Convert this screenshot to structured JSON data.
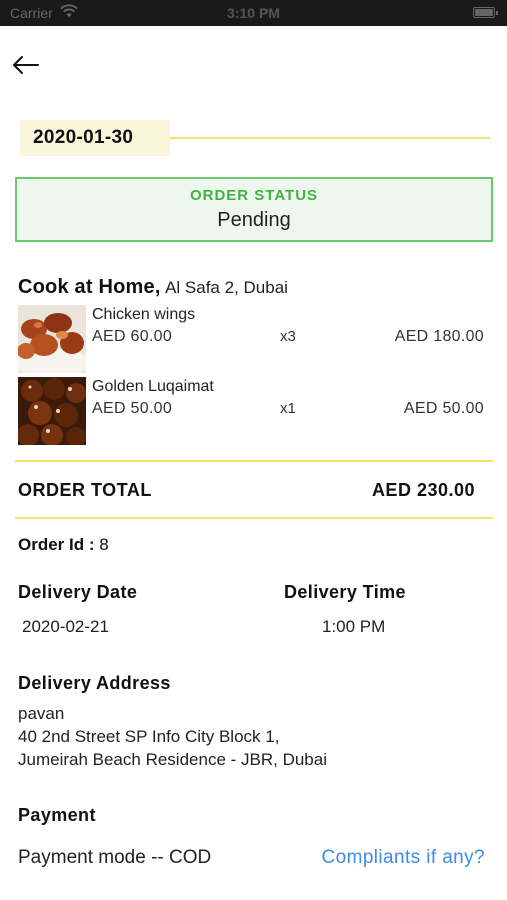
{
  "status_bar": {
    "carrier": "Carrier",
    "time": "3:10 PM"
  },
  "order": {
    "date": "2020-01-30",
    "status_label": "ORDER STATUS",
    "status_value": "Pending",
    "restaurant_name": "Cook at Home,",
    "restaurant_location": "Al Safa 2, Dubai",
    "items": [
      {
        "name": "Chicken wings",
        "price": "AED 60.00",
        "qty": "x3",
        "total": "AED 180.00"
      },
      {
        "name": "Golden Luqaimat",
        "price": "AED 50.00",
        "qty": "x1",
        "total": "AED 50.00"
      }
    ],
    "total_label": "ORDER TOTAL",
    "total_value": "AED 230.00",
    "order_id_label": "Order Id :",
    "order_id_value": "8",
    "delivery_date_label": "Delivery Date",
    "delivery_date_value": "2020-02-21",
    "delivery_time_label": "Delivery Time",
    "delivery_time_value": "1:00 PM",
    "address_label": "Delivery Address",
    "address_name": "pavan",
    "address_line1": "40 2nd Street SP Info City Block 1,",
    "address_line2": "Jumeirah Beach Residence - JBR, Dubai",
    "payment_label": "Payment",
    "payment_mode": "Payment mode -- COD",
    "complaints_link": "Compliants if any?"
  },
  "colors": {
    "accent_yellow": "#f1e36b",
    "status_green": "#3fb33f",
    "status_bg": "#eef7ee",
    "link_blue": "#3d8be8"
  },
  "icons": {
    "back": "arrow-left-icon",
    "wifi": "wifi-icon",
    "battery": "battery-icon"
  }
}
